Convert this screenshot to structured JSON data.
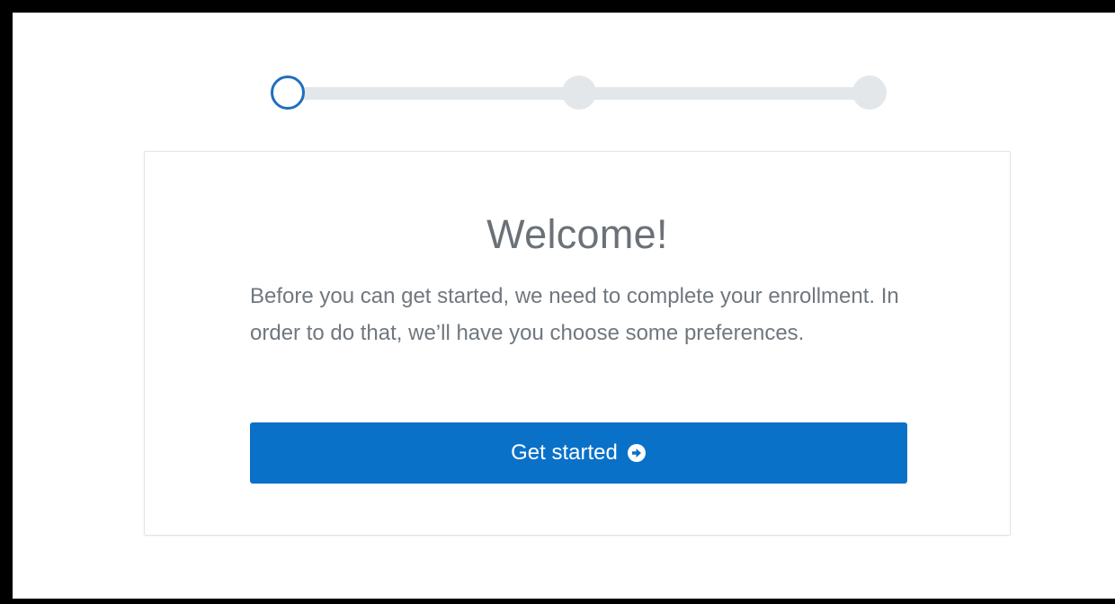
{
  "stepper": {
    "steps": [
      "step-1",
      "step-2",
      "step-3"
    ],
    "active_step": 1,
    "colors": {
      "active": "#1f6fbf",
      "inactive": "#e4e7ea"
    }
  },
  "card": {
    "title": "Welcome!",
    "body": "Before you can get started, we need to complete your enrollment. In order to do that, we’ll have you choose some preferences.",
    "button_label": "Get started",
    "button_icon": "arrow-circle-right-icon",
    "button_color": "#0a71c9"
  }
}
